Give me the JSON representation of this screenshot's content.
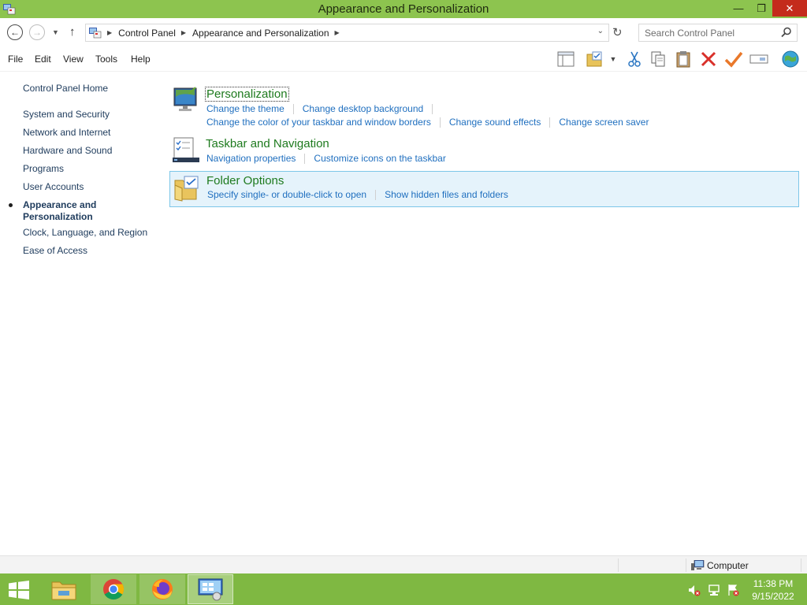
{
  "window": {
    "title": "Appearance and Personalization",
    "minimize_glyph": "—",
    "maximize_glyph": "❐",
    "close_glyph": "✕"
  },
  "address": {
    "breadcrumbs": [
      "Control Panel",
      "Appearance and Personalization"
    ],
    "search_placeholder": "Search Control Panel"
  },
  "menu": [
    "File",
    "Edit",
    "View",
    "Tools",
    "Help"
  ],
  "sidebar": {
    "home": "Control Panel Home",
    "items": [
      "System and Security",
      "Network and Internet",
      "Hardware and Sound",
      "Programs",
      "User Accounts",
      "Appearance and Personalization",
      "Clock, Language, and Region",
      "Ease of Access"
    ],
    "active_index": 5
  },
  "categories": [
    {
      "title": "Personalization",
      "icon": "personalization-icon",
      "tasks": [
        [
          "Change the theme",
          "Change desktop background"
        ],
        [
          "Change the color of your taskbar and window borders",
          "Change sound effects",
          "Change screen saver"
        ]
      ]
    },
    {
      "title": "Taskbar and Navigation",
      "icon": "taskbar-icon",
      "tasks": [
        [
          "Navigation properties",
          "Customize icons on the taskbar"
        ]
      ]
    },
    {
      "title": "Folder Options",
      "icon": "folder-options-icon",
      "tasks": [
        [
          "Specify single- or double-click to open",
          "Show hidden files and folders"
        ]
      ]
    }
  ],
  "statusbar": {
    "location": "Computer"
  },
  "taskbar": {
    "apps": [
      "file-explorer-icon",
      "chrome-icon",
      "firefox-icon",
      "control-panel-icon"
    ],
    "time": "11:38 PM",
    "date": "9/15/2022"
  },
  "colors": {
    "accent": "#8dc44f",
    "taskbar": "#7fb842",
    "link": "#1f6fbf",
    "category_title": "#1e7a1e",
    "highlight": "#e5f3fb"
  }
}
